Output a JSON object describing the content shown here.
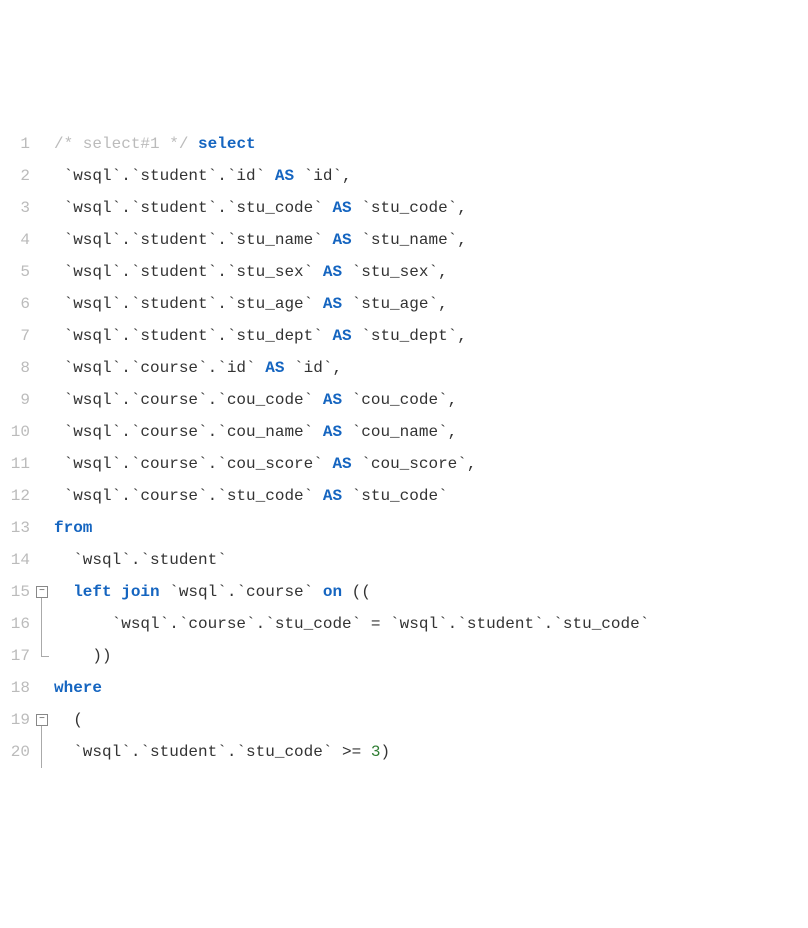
{
  "chart_data": {
    "type": "table",
    "title": "SQL code listing",
    "rows": [
      {
        "n": 1,
        "tokens": [
          {
            "t": "cm",
            "v": "/* select#1 */ "
          },
          {
            "t": "kw",
            "v": "select"
          }
        ]
      },
      {
        "n": 2,
        "tokens": [
          {
            "t": "txt",
            "v": " `wsql`.`student`.`id` "
          },
          {
            "t": "kw",
            "v": "AS"
          },
          {
            "t": "txt",
            "v": " `id`,"
          }
        ]
      },
      {
        "n": 3,
        "tokens": [
          {
            "t": "txt",
            "v": " `wsql`.`student`.`stu_code` "
          },
          {
            "t": "kw",
            "v": "AS"
          },
          {
            "t": "txt",
            "v": " `stu_code`,"
          }
        ]
      },
      {
        "n": 4,
        "tokens": [
          {
            "t": "txt",
            "v": " `wsql`.`student`.`stu_name` "
          },
          {
            "t": "kw",
            "v": "AS"
          },
          {
            "t": "txt",
            "v": " `stu_name`,"
          }
        ]
      },
      {
        "n": 5,
        "tokens": [
          {
            "t": "txt",
            "v": " `wsql`.`student`.`stu_sex` "
          },
          {
            "t": "kw",
            "v": "AS"
          },
          {
            "t": "txt",
            "v": " `stu_sex`,"
          }
        ]
      },
      {
        "n": 6,
        "tokens": [
          {
            "t": "txt",
            "v": " `wsql`.`student`.`stu_age` "
          },
          {
            "t": "kw",
            "v": "AS"
          },
          {
            "t": "txt",
            "v": " `stu_age`,"
          }
        ]
      },
      {
        "n": 7,
        "tokens": [
          {
            "t": "txt",
            "v": " `wsql`.`student`.`stu_dept` "
          },
          {
            "t": "kw",
            "v": "AS"
          },
          {
            "t": "txt",
            "v": " `stu_dept`,"
          }
        ]
      },
      {
        "n": 8,
        "tokens": [
          {
            "t": "txt",
            "v": " `wsql`.`course`.`id` "
          },
          {
            "t": "kw",
            "v": "AS"
          },
          {
            "t": "txt",
            "v": " `id`,"
          }
        ]
      },
      {
        "n": 9,
        "tokens": [
          {
            "t": "txt",
            "v": " `wsql`.`course`.`cou_code` "
          },
          {
            "t": "kw",
            "v": "AS"
          },
          {
            "t": "txt",
            "v": " `cou_code`,"
          }
        ]
      },
      {
        "n": 10,
        "tokens": [
          {
            "t": "txt",
            "v": " `wsql`.`course`.`cou_name` "
          },
          {
            "t": "kw",
            "v": "AS"
          },
          {
            "t": "txt",
            "v": " `cou_name`,"
          }
        ]
      },
      {
        "n": 11,
        "tokens": [
          {
            "t": "txt",
            "v": " `wsql`.`course`.`cou_score` "
          },
          {
            "t": "kw",
            "v": "AS"
          },
          {
            "t": "txt",
            "v": " `cou_score`,"
          }
        ]
      },
      {
        "n": 12,
        "tokens": [
          {
            "t": "txt",
            "v": " `wsql`.`course`.`stu_code` "
          },
          {
            "t": "kw",
            "v": "AS"
          },
          {
            "t": "txt",
            "v": " `stu_code`"
          }
        ]
      },
      {
        "n": 13,
        "tokens": [
          {
            "t": "kw",
            "v": "from"
          }
        ]
      },
      {
        "n": 14,
        "tokens": [
          {
            "t": "txt",
            "v": "  `wsql`.`student`"
          }
        ]
      },
      {
        "n": 15,
        "fold": "open",
        "tokens": [
          {
            "t": "txt",
            "v": "  "
          },
          {
            "t": "kw",
            "v": "left join"
          },
          {
            "t": "txt",
            "v": " `wsql`.`course` "
          },
          {
            "t": "kw",
            "v": "on"
          },
          {
            "t": "txt",
            "v": " (("
          }
        ]
      },
      {
        "n": 16,
        "fold": "mid",
        "tokens": [
          {
            "t": "txt",
            "v": "      `wsql`.`course`.`stu_code` = `wsql`.`student`.`stu_code`"
          }
        ]
      },
      {
        "n": 17,
        "fold": "end",
        "tokens": [
          {
            "t": "txt",
            "v": "    ))"
          }
        ]
      },
      {
        "n": 18,
        "tokens": [
          {
            "t": "kw",
            "v": "where"
          }
        ]
      },
      {
        "n": 19,
        "fold": "open",
        "tokens": [
          {
            "t": "txt",
            "v": "  ("
          }
        ]
      },
      {
        "n": 20,
        "fold": "mid",
        "tokens": [
          {
            "t": "txt",
            "v": "  `wsql`.`student`.`stu_code` >= "
          },
          {
            "t": "num",
            "v": "3"
          },
          {
            "t": "txt",
            "v": ")"
          }
        ]
      }
    ]
  }
}
